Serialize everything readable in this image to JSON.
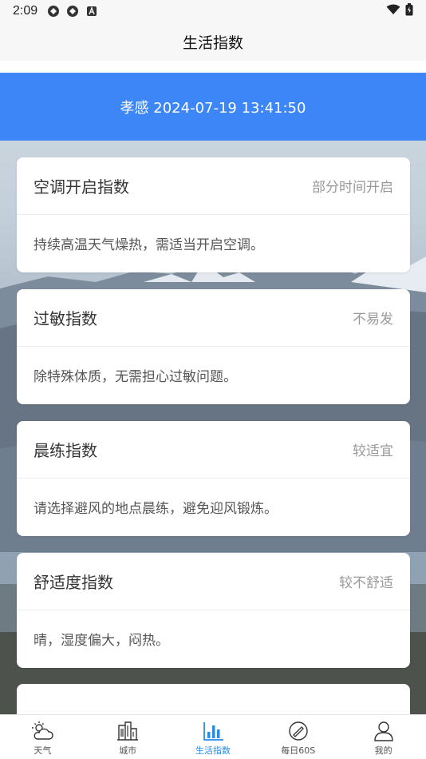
{
  "status_bar": {
    "time": "2:09"
  },
  "header": {
    "title": "生活指数"
  },
  "location": {
    "text": "孝感 2024-07-19 13:41:50"
  },
  "cards": [
    {
      "name": "空调开启指数",
      "level": "部分时间开启",
      "desc": "持续高温天气燥热，需适当开启空调。"
    },
    {
      "name": "过敏指数",
      "level": "不易发",
      "desc": "除特殊体质，无需担心过敏问题。"
    },
    {
      "name": "晨练指数",
      "level": "较适宜",
      "desc": "请选择避风的地点晨练，避免迎风锻炼。"
    },
    {
      "name": "舒适度指数",
      "level": "较不舒适",
      "desc": "晴，湿度偏大，闷热。"
    }
  ],
  "tabs": [
    {
      "label": "天气",
      "icon": "cloud-sun-icon"
    },
    {
      "label": "城市",
      "icon": "city-icon"
    },
    {
      "label": "生活指数",
      "icon": "bar-chart-icon"
    },
    {
      "label": "每日60S",
      "icon": "news-icon"
    },
    {
      "label": "我的",
      "icon": "user-icon"
    }
  ],
  "colors": {
    "accent": "#3d86f7",
    "active_tab": "#2a8ce8"
  }
}
